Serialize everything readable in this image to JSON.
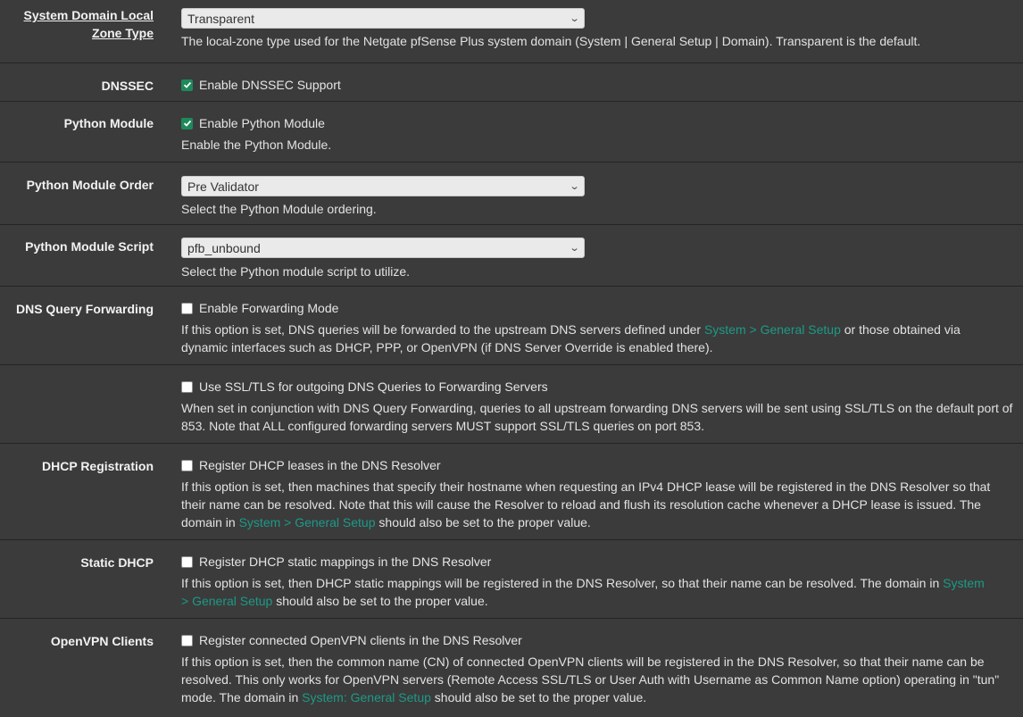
{
  "rows": {
    "zone_type": {
      "label": "System Domain Local Zone Type",
      "select_value": "Transparent",
      "help": "The local-zone type used for the Netgate pfSense Plus system domain (System | General Setup | Domain). Transparent is the default."
    },
    "dnssec": {
      "label": "DNSSEC",
      "checkbox_label": "Enable DNSSEC Support",
      "checked": true
    },
    "python_module": {
      "label": "Python Module",
      "checkbox_label": "Enable Python Module",
      "checked": true,
      "help": "Enable the Python Module."
    },
    "python_order": {
      "label": "Python Module Order",
      "select_value": "Pre Validator",
      "help": "Select the Python Module ordering."
    },
    "python_script": {
      "label": "Python Module Script",
      "select_value": "pfb_unbound",
      "help": "Select the Python module script to utilize."
    },
    "forwarding": {
      "label": "DNS Query Forwarding",
      "checkbox_label": "Enable Forwarding Mode",
      "checked": false,
      "help_before": "If this option is set, DNS queries will be forwarded to the upstream DNS servers defined under ",
      "link": "System > General Setup",
      "help_after": " or those obtained via dynamic interfaces such as DHCP, PPP, or OpenVPN (if DNS Server Override is enabled there)."
    },
    "ssl_tls": {
      "checkbox_label": "Use SSL/TLS for outgoing DNS Queries to Forwarding Servers",
      "checked": false,
      "help": "When set in conjunction with DNS Query Forwarding, queries to all upstream forwarding DNS servers will be sent using SSL/TLS on the default port of 853. Note that ALL configured forwarding servers MUST support SSL/TLS queries on port 853."
    },
    "dhcp_reg": {
      "label": "DHCP Registration",
      "checkbox_label": "Register DHCP leases in the DNS Resolver",
      "checked": false,
      "help_before": "If this option is set, then machines that specify their hostname when requesting an IPv4 DHCP lease will be registered in the DNS Resolver so that their name can be resolved. Note that this will cause the Resolver to reload and flush its resolution cache whenever a DHCP lease is issued. The domain in ",
      "link": "System > General Setup",
      "help_after": " should also be set to the proper value."
    },
    "static_dhcp": {
      "label": "Static DHCP",
      "checkbox_label": "Register DHCP static mappings in the DNS Resolver",
      "checked": false,
      "help_before": "If this option is set, then DHCP static mappings will be registered in the DNS Resolver, so that their name can be resolved. The domain in ",
      "link": "System > General Setup",
      "help_after": " should also be set to the proper value."
    },
    "openvpn": {
      "label": "OpenVPN Clients",
      "checkbox_label": "Register connected OpenVPN clients in the DNS Resolver",
      "checked": false,
      "help_before": "If this option is set, then the common name (CN) of connected OpenVPN clients will be registered in the DNS Resolver, so that their name can be resolved. This only works for OpenVPN servers (Remote Access SSL/TLS or User Auth with Username as Common Name option) operating in \"tun\" mode. The domain in ",
      "link": "System: General Setup",
      "help_after": " should also be set to the proper value."
    }
  },
  "icons": {
    "select_arrow": "chevron-down-icon",
    "check": "check-icon"
  },
  "colors": {
    "link": "#1c9a86",
    "checkbox_checked": "#1e8a5c",
    "background": "#3b3b3b"
  }
}
